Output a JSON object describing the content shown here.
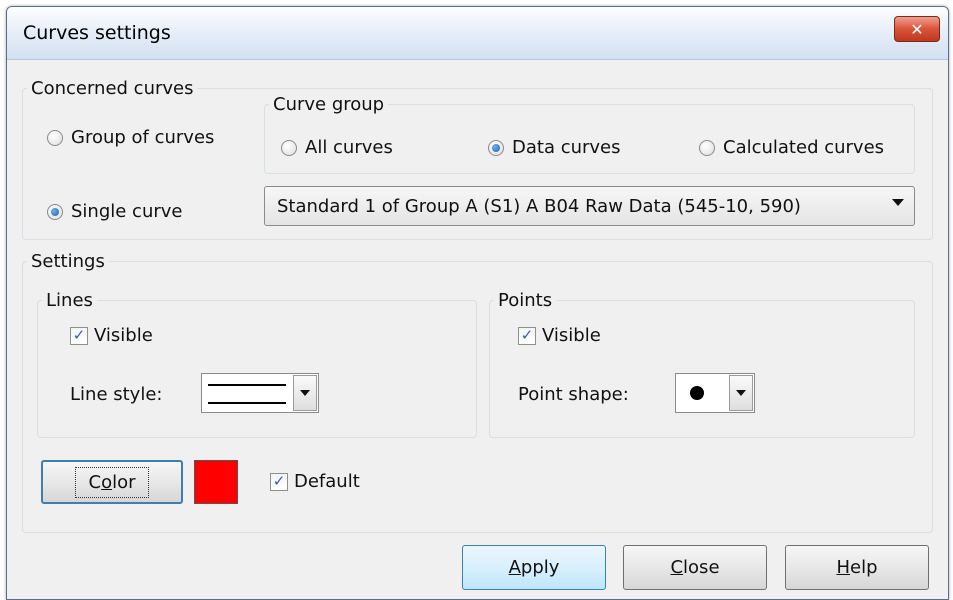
{
  "window": {
    "title": "Curves settings",
    "close_icon": "close-icon"
  },
  "concerned_curves": {
    "legend": "Concerned curves",
    "group_of_curves": "Group of curves",
    "single_curve": "Single curve",
    "selected_mode": "single_curve"
  },
  "curve_group": {
    "legend": "Curve group",
    "all_curves": "All curves",
    "data_curves": "Data curves",
    "calculated_curves": "Calculated curves",
    "selected": "data_curves"
  },
  "curve_select": {
    "value": "Standard 1 of Group A (S1) A B04 Raw Data (545-10, 590)"
  },
  "settings": {
    "legend": "Settings",
    "lines": {
      "legend": "Lines",
      "visible_label": "Visible",
      "visible_checked": true,
      "style_label": "Line style:"
    },
    "points": {
      "legend": "Points",
      "visible_label": "Visible",
      "visible_checked": true,
      "shape_label": "Point shape:"
    },
    "color": {
      "button_prefix": "C",
      "button_accel": "o",
      "button_suffix": "lor",
      "swatch": "#ff0000"
    },
    "default_label": "Default",
    "default_checked": true
  },
  "buttons": {
    "apply": {
      "accel": "A",
      "rest": "pply"
    },
    "close": {
      "accel": "C",
      "rest": "lose"
    },
    "help": {
      "accel": "H",
      "rest": "elp"
    }
  },
  "colors": {
    "accent": "#3c7fb1",
    "titlebar": "#dbe6f4",
    "close": "#c9452c"
  }
}
